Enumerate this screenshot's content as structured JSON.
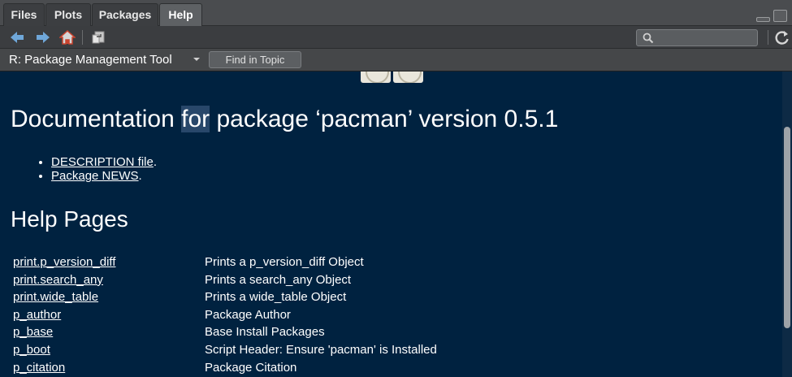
{
  "tabs": [
    {
      "label": "Files",
      "active": false
    },
    {
      "label": "Plots",
      "active": false
    },
    {
      "label": "Packages",
      "active": false
    },
    {
      "label": "Help",
      "active": true
    }
  ],
  "toolbar": {
    "icons": [
      "back-arrow-icon",
      "forward-arrow-icon",
      "home-icon",
      "open-in-window-icon",
      "search-icon",
      "refresh-icon"
    ],
    "search_placeholder": ""
  },
  "topic": {
    "title": "R: Package Management Tool",
    "find_button": "Find in Topic"
  },
  "doc": {
    "heading_pre": "Documentation ",
    "heading_highlight": "for",
    "heading_post": " package ‘pacman’ version 0.5.1",
    "links": [
      {
        "text": "DESCRIPTION file",
        "suffix": "."
      },
      {
        "text": "Package NEWS",
        "suffix": "."
      }
    ],
    "help_pages_heading": "Help Pages",
    "help_pages": [
      {
        "name": "print.p_version_diff",
        "desc": "Prints a p_version_diff Object"
      },
      {
        "name": "print.search_any",
        "desc": "Prints a search_any Object"
      },
      {
        "name": "print.wide_table",
        "desc": "Prints a wide_table Object"
      },
      {
        "name": "p_author",
        "desc": "Package Author"
      },
      {
        "name": "p_base",
        "desc": "Base Install Packages"
      },
      {
        "name": "p_boot",
        "desc": "Script Header: Ensure 'pacman' is Installed"
      },
      {
        "name": "p_citation",
        "desc": "Package Citation"
      }
    ]
  },
  "colors": {
    "background": "#002240",
    "highlight": "#28476a",
    "back_arrow": "#6fa7d9",
    "home": "#c9442f"
  }
}
